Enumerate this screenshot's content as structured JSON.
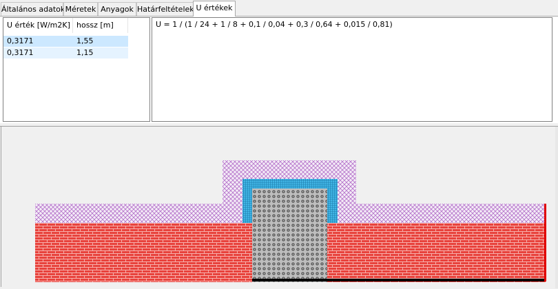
{
  "tabs": [
    {
      "label": "Általános adatok"
    },
    {
      "label": "Méretek"
    },
    {
      "label": "Anyagok"
    },
    {
      "label": "Határfeltételek"
    },
    {
      "label": "U értékek",
      "active": true
    }
  ],
  "u_list": {
    "columns": [
      "U érték [W/m2K]",
      "hossz [m]"
    ],
    "rows": [
      {
        "u": "0,3171",
        "length": "1,55",
        "selected": true
      },
      {
        "u": "0,3171",
        "length": "1,15",
        "selected": false
      }
    ]
  },
  "formula": {
    "text": "U = 1 / (1 / 24 + 1 / 8 + 0,1 / 0,04 + 0,3 / 0,64 + 0,015 / 0,81)"
  },
  "colors": {
    "brick_fill": "#e8423c",
    "brick_mortar": "#f7b1ad",
    "insulation_fill": "#f4ecf7",
    "insulation_hatch": "#b36fc9",
    "blue_layer": "#41b6e6",
    "blue_grid": "#1f7fb0",
    "concrete_fill": "#bdbdbd",
    "concrete_dots": "#333333",
    "boundary_red": "#e00000",
    "boundary_black": "#000000"
  }
}
